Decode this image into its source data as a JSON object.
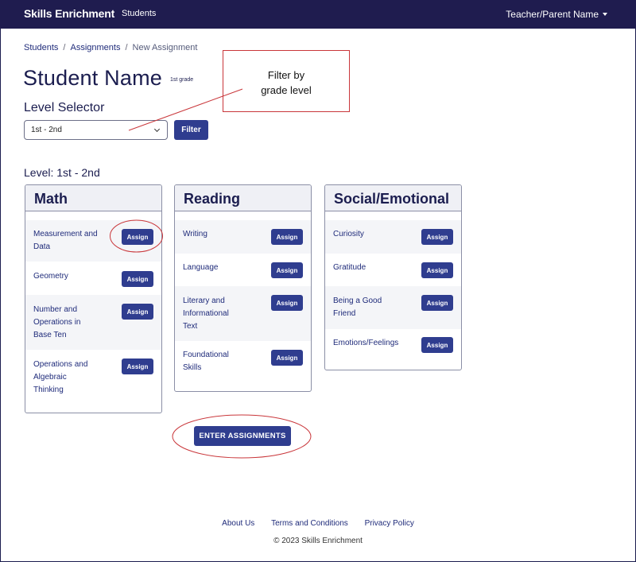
{
  "navbar": {
    "brand": "Skills Enrichment",
    "students_link": "Students",
    "user_menu": "Teacher/Parent Name"
  },
  "breadcrumb": {
    "items": [
      "Students",
      "Assignments",
      "New Assignment"
    ],
    "separator": "/"
  },
  "student": {
    "name": "Student Name",
    "grade": "1st grade"
  },
  "level_selector": {
    "label": "Level Selector",
    "selected": "1st - 2nd",
    "filter_button": "Filter"
  },
  "annotation": {
    "callout_line1": "Filter by",
    "callout_line2": "grade level"
  },
  "level_heading": "Level: 1st - 2nd",
  "assign_label": "Assign",
  "cards": {
    "math": {
      "title": "Math",
      "skills": [
        "Measurement and Data",
        "Geometry",
        "Number and Operations in Base Ten",
        "Operations and Algebraic Thinking"
      ]
    },
    "reading": {
      "title": "Reading",
      "skills": [
        "Writing",
        "Language",
        "Literary and Informational Text",
        "Foundational Skills"
      ]
    },
    "social": {
      "title": "Social/Emotional",
      "skills": [
        "Curiosity",
        "Gratitude",
        "Being a Good Friend",
        "Emotions/Feelings"
      ]
    }
  },
  "enter_button": "ENTER ASSIGNMENTS",
  "footer": {
    "links": [
      "About Us",
      "Terms and Conditions",
      "Privacy Policy"
    ],
    "copyright": "© 2023 Skills Enrichment"
  },
  "colors": {
    "navbar": "#1f1c4f",
    "primary_button": "#2f3d8f",
    "annotation_red": "#c9363a",
    "card_header": "#eff0f5"
  }
}
